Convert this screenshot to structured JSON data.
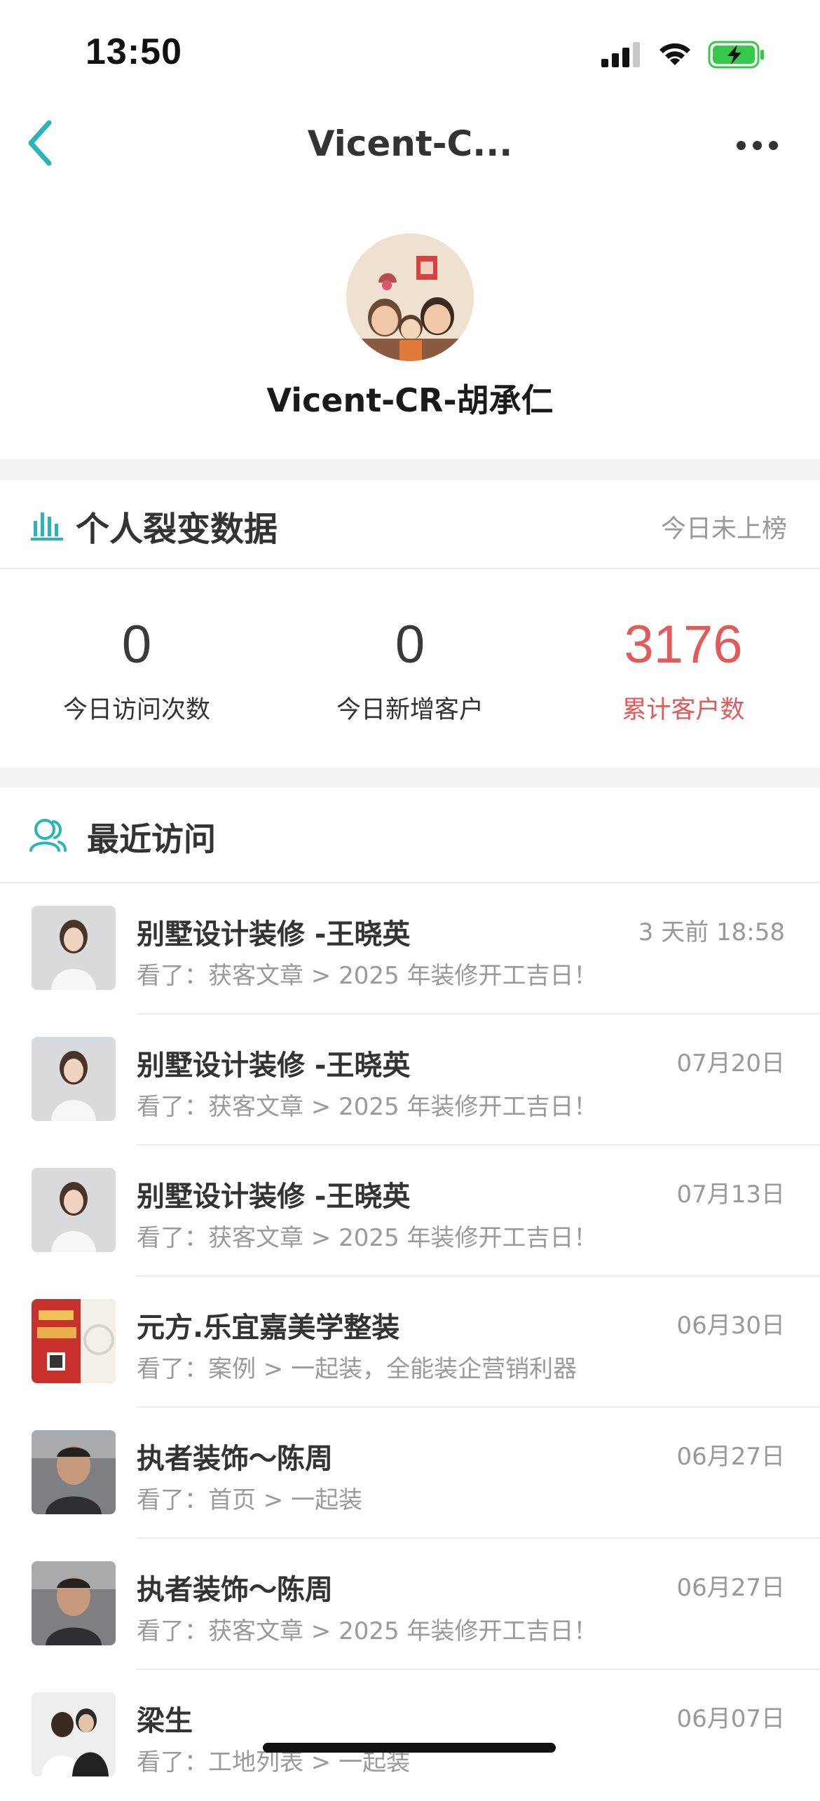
{
  "status_bar": {
    "time": "13:50"
  },
  "nav": {
    "title": "Vicent-C...",
    "back_icon": "chevron-left-icon",
    "more_icon": "ellipsis-icon"
  },
  "profile": {
    "name": "Vicent-CR-胡承仁"
  },
  "stats": {
    "title": "个人裂变数据",
    "rank_status": "今日未上榜",
    "items": [
      {
        "value": "0",
        "label": "今日访问次数"
      },
      {
        "value": "0",
        "label": "今日新增客户"
      },
      {
        "value": "3176",
        "label": "累计客户数"
      }
    ]
  },
  "recent": {
    "title": "最近访问",
    "items": [
      {
        "name": "别墅设计装修 -王晓英",
        "time": "3 天前 18:58",
        "action": "看了：获客文章 > 2025 年装修开工吉日！"
      },
      {
        "name": "别墅设计装修 -王晓英",
        "time": "07月20日",
        "action": "看了：获客文章 > 2025 年装修开工吉日！"
      },
      {
        "name": "别墅设计装修 -王晓英",
        "time": "07月13日",
        "action": "看了：获客文章 > 2025 年装修开工吉日！"
      },
      {
        "name": "元方.乐宜嘉美学整装",
        "time": "06月30日",
        "action": "看了：案例 > 一起装，全能装企营销利器"
      },
      {
        "name": "执者装饰～陈周",
        "time": "06月27日",
        "action": "看了：首页 > 一起装"
      },
      {
        "name": "执者装饰～陈周",
        "time": "06月27日",
        "action": "看了：获客文章 > 2025 年装修开工吉日！"
      },
      {
        "name": "梁生",
        "time": "06月07日",
        "action": "看了：工地列表 > 一起装"
      }
    ]
  },
  "colors": {
    "accent_teal": "#2bb5b8",
    "highlight_red": "#e25a5a",
    "battery_green": "#37c84a",
    "text_dark": "#333333",
    "text_muted": "#999999"
  }
}
